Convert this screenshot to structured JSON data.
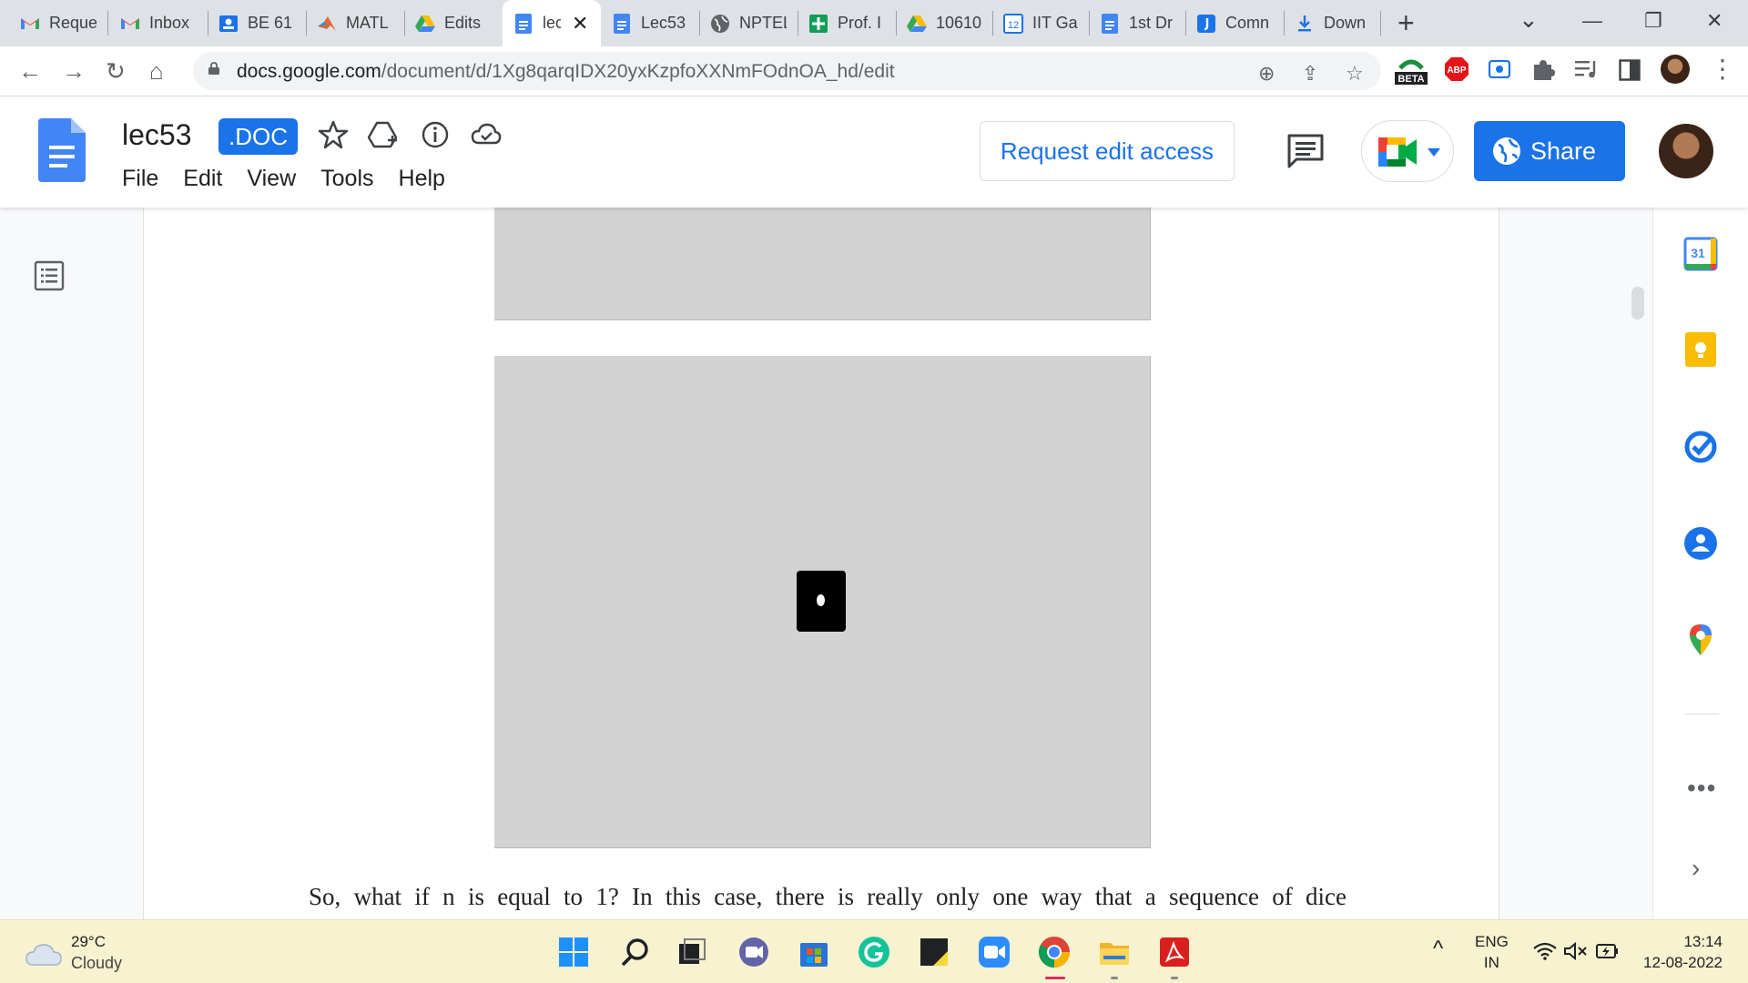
{
  "browser": {
    "tabs": [
      {
        "title": "Reque",
        "icon": "gmail-icon"
      },
      {
        "title": "Inbox",
        "icon": "gmail-icon"
      },
      {
        "title": "BE 61",
        "icon": "classroom-icon"
      },
      {
        "title": "MATL",
        "icon": "matlab-icon"
      },
      {
        "title": "Edits",
        "icon": "drive-icon"
      },
      {
        "title": "lec",
        "icon": "docs-icon",
        "active": true
      },
      {
        "title": "Lec53",
        "icon": "docs-icon"
      },
      {
        "title": "NPTEL",
        "icon": "globe-icon"
      },
      {
        "title": "Prof. I",
        "icon": "sheets-plus-icon"
      },
      {
        "title": "10610",
        "icon": "drive-icon"
      },
      {
        "title": "IIT Ga",
        "icon": "calendar-icon"
      },
      {
        "title": "1st Dr",
        "icon": "docs-icon"
      },
      {
        "title": "Comn",
        "icon": "jamboard-icon"
      },
      {
        "title": "Down",
        "icon": "download-icon"
      }
    ],
    "new_tab_symbol": "+",
    "window_controls": {
      "minimize": "—",
      "restore": "❐",
      "close": "✕",
      "tab_search": "⌄"
    },
    "url_host": "docs.google.com",
    "url_path": "/document/d/1Xg8qarqIDX20yxKzpfoXXNmFOdnOA_hd/edit",
    "extensions": [
      "zoom-icon",
      "share-page-icon",
      "bookmark-star-icon",
      "beta-extension-icon",
      "adblock-icon",
      "screen-capture-icon",
      "puzzle-icon",
      "media-control-icon",
      "sidebar-icon",
      "profile-avatar"
    ],
    "beta_label": "BETA",
    "abp_label": "ABP",
    "calendar_tab_number": "12"
  },
  "docs_header": {
    "title": "lec53",
    "badge": ".DOC",
    "menu": [
      "File",
      "Edit",
      "View",
      "Tools",
      "Help"
    ],
    "request_edit_label": "Request edit access",
    "share_label": "Share"
  },
  "document": {
    "paragraph": "So, what if n is equal to 1? In this case, there is really only one way that a sequence of dice"
  },
  "side_panel": {
    "items": [
      "calendar-icon",
      "keep-icon",
      "tasks-icon",
      "contacts-icon",
      "maps-icon"
    ],
    "calendar_number": "31",
    "more": "•••",
    "expand": "›"
  },
  "taskbar": {
    "weather_temp": "29°C",
    "weather_condition": "Cloudy",
    "lang_line1": "ENG",
    "lang_line2": "IN",
    "time": "13:14",
    "date": "12-08-2022"
  },
  "colors": {
    "accent_blue": "#1a73e8",
    "taskbar_bg": "#f7f2cf",
    "image_placeholder": "#d3d3d3"
  }
}
